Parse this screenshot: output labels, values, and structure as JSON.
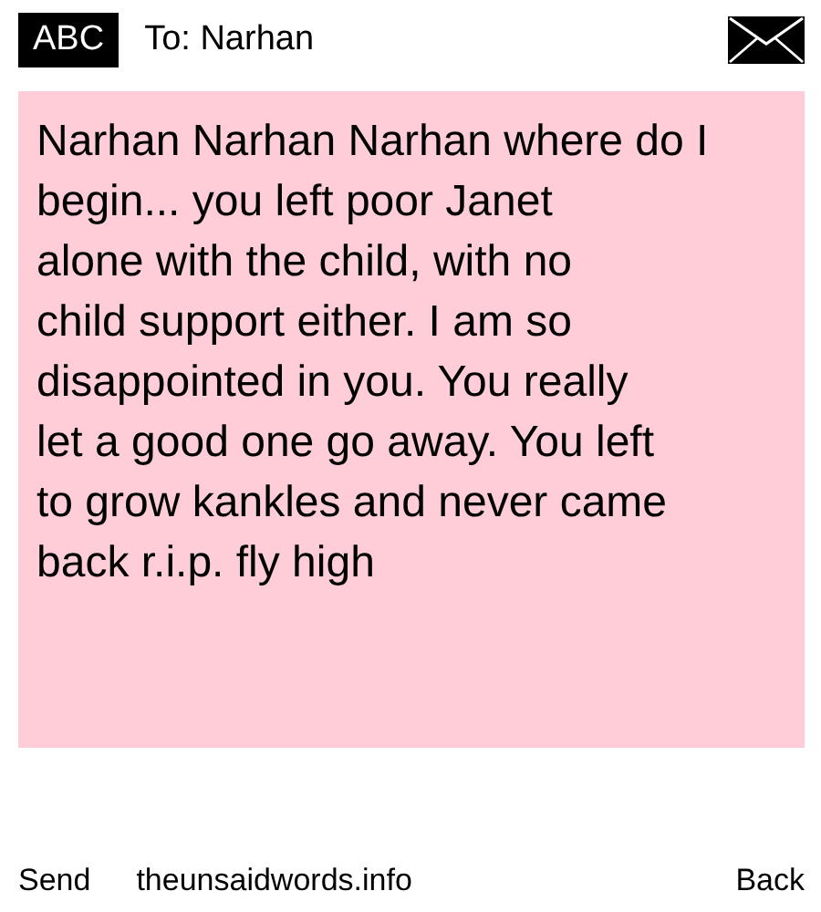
{
  "header": {
    "mode": "ABC",
    "recipient": "To: Narhan"
  },
  "message": {
    "lines": [
      "Narhan Narhan Narhan where do I",
      "begin... you left poor Janet",
      "alone with the child, with no",
      "child support either. I am so",
      "disappointed in you. You really",
      "let a good one go away. You left",
      "to grow kankles and never came",
      "back r.i.p. fly high"
    ]
  },
  "softkeys": {
    "left": "Send",
    "middle": "theunsaidwords.info",
    "right": "Back"
  }
}
